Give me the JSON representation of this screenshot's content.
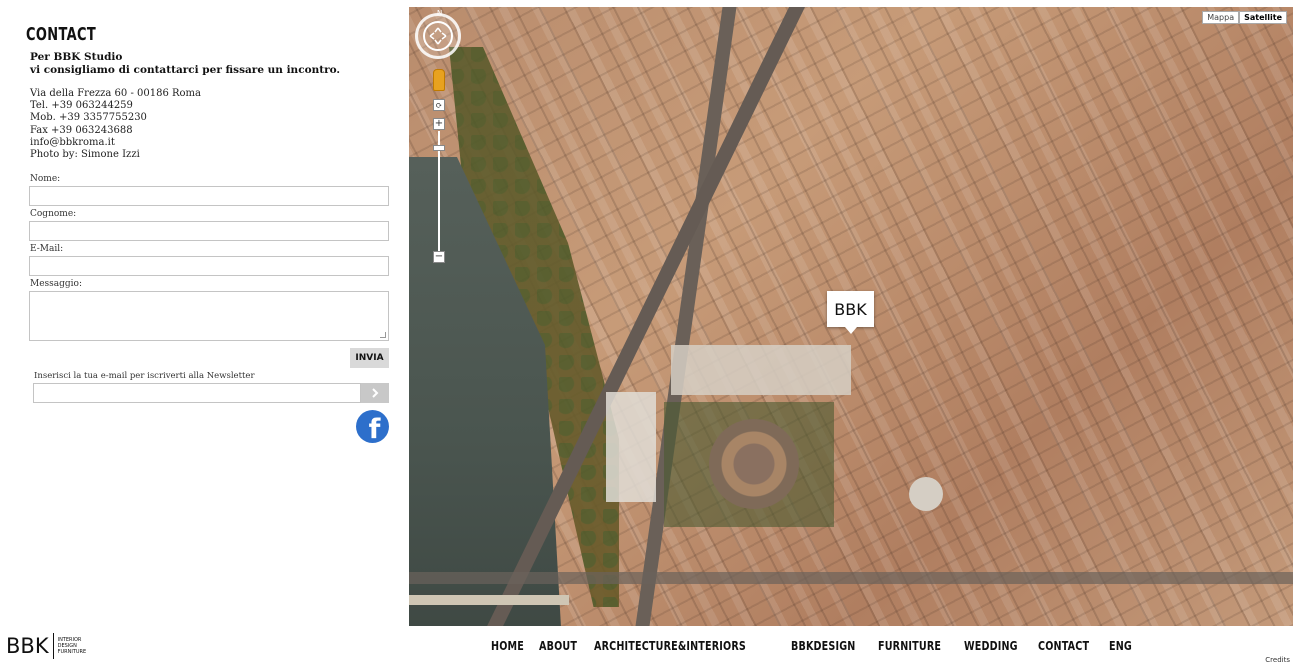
{
  "contact": {
    "heading": "CONTACT",
    "intro_line1": "Per BBK Studio",
    "intro_line2": "vi consigliamo di contattarci per fissare un incontro.",
    "address": "Via della Frezza 60 - 00186 Roma",
    "tel": "Tel. +39 063244259",
    "mob": "Mob. +39 3357755230",
    "fax": "Fax +39 063243688",
    "email": "info@bbkroma.it",
    "photo": "Photo by: Simone Izzi"
  },
  "form": {
    "nome_label": "Nome:",
    "cognome_label": "Cognome:",
    "email_label": "E-Mail:",
    "messaggio_label": "Messaggio:",
    "submit_label": "INVIA"
  },
  "newsletter": {
    "label": "Inserisci la tua e-mail per iscriverti alla Newsletter",
    "button_icon": "chevron-right-icon"
  },
  "social": {
    "facebook_glyph": "f",
    "facebook_color": "#2d6fcb"
  },
  "map": {
    "marker_label": "BBK",
    "compass_label": "N",
    "type_options": [
      "Mappa",
      "Satellite"
    ],
    "active_type": "Satellite",
    "zoom_in": "+",
    "zoom_out": "−"
  },
  "footer": {
    "logo_main": "BBK",
    "logo_sub": [
      "INTERIOR",
      "DESIGN",
      "FURNITURE"
    ],
    "nav": [
      "HOME",
      "ABOUT",
      "ARCHITECTURE&INTERIORS",
      "BBKDESIGN",
      "FURNITURE",
      "WEDDING",
      "CONTACT",
      "ENG"
    ],
    "credits": "Credits"
  }
}
